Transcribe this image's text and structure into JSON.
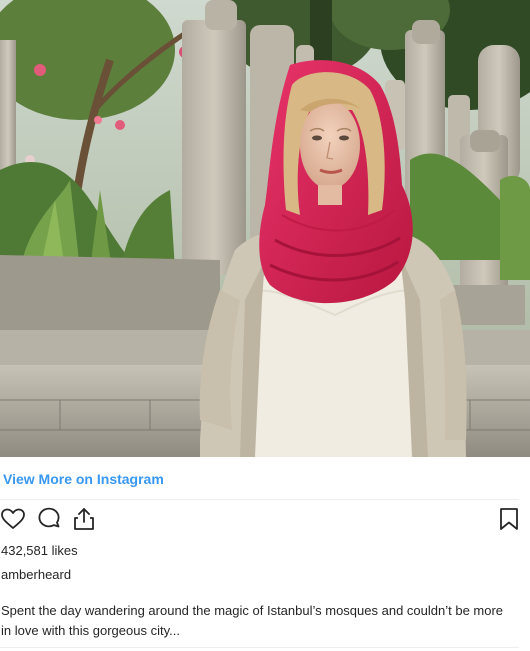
{
  "post": {
    "view_more_label": "View More on Instagram",
    "likes_text": "432,581 likes",
    "username": "amberheard",
    "caption": "Spent the day wandering around the magic of Istanbul’s mosques and couldn’t be more in love with this gorgeous city..."
  },
  "actions": {
    "like_icon": "heart-icon",
    "comment_icon": "comment-icon",
    "share_icon": "share-icon",
    "save_icon": "bookmark-icon"
  },
  "colors": {
    "link": "#3897f0",
    "text": "#262626",
    "scarf": "#d81e4f"
  }
}
